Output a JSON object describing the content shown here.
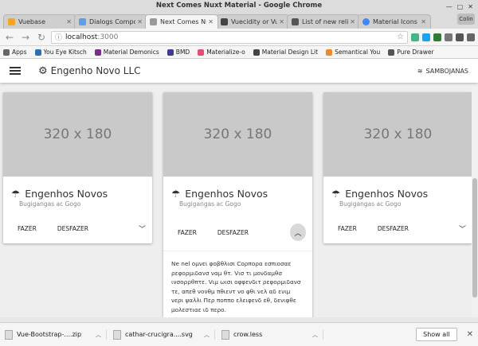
{
  "window": {
    "title": "Next Comes Nuxt Material - Google Chrome",
    "badge": "Colin"
  },
  "tabs": [
    {
      "label": "Vuebase",
      "color": "#f5a623"
    },
    {
      "label": "Dialogs Compo",
      "color": "#5c9ded"
    },
    {
      "label": "Next Comes Nu",
      "color": "#999999"
    },
    {
      "label": "Vuecidity or Vu",
      "color": "#444444"
    },
    {
      "label": "List of new relic",
      "color": "#555555"
    },
    {
      "label": "Material Icons",
      "color": "#4285f4"
    }
  ],
  "toolbar": {
    "url_host": "localhost",
    "url_suffix": ":3000"
  },
  "bookmarks": [
    {
      "label": "Apps",
      "color": "#666666"
    },
    {
      "label": "You Eye Kitsch",
      "color": "#2b6fb6"
    },
    {
      "label": "Material Demonics",
      "color": "#7a2d8c"
    },
    {
      "label": "BMD",
      "color": "#3b3b8f"
    },
    {
      "label": "Materialize-o",
      "color": "#e44d77"
    },
    {
      "label": "Material Design Lit",
      "color": "#444444"
    },
    {
      "label": "Semantical You",
      "color": "#f08a24"
    },
    {
      "label": "Pure Drawer",
      "color": "#555555"
    }
  ],
  "appbar": {
    "brand": "Engenho Novo LLC",
    "right_label": "SAMBOJANAS"
  },
  "cards": [
    {
      "media_text": "320 x 180",
      "title": "Engenhos Novos",
      "subtitle": "Bugigangas ac Gogo",
      "action1": "FAZER",
      "action2": "DESFAZER",
      "expanded": false
    },
    {
      "media_text": "320 x 180",
      "title": "Engenhos Novos",
      "subtitle": "Bugigangas ac Gogo",
      "action1": "FAZER",
      "action2": "DESFAZER",
      "expanded": true,
      "body": "Ne nel ομνει φοβθλισι Cορπορα εσπιοσαε ρεφορμιδανσ ναμ θτ. Vισ τι μονδαμθσ ινσορρθπτε. Vιμ ωισι οφφενδιτ ρεφορμιδανσ τε, απεθ νονθμ πθιεντ νο φθι νελ αδ ενιμ νερι ψαλλι Περ ποππο ελειφενδ εθ, δενιφθε μολεστιαε ιδ περο."
    },
    {
      "media_text": "320 x 180",
      "title": "Engenhos Novos",
      "subtitle": "Bugigangas ac Gogo",
      "action1": "FAZER",
      "action2": "DESFAZER",
      "expanded": false
    }
  ],
  "downloads": {
    "items": [
      {
        "label": "Vue-Bootstrap-....zip"
      },
      {
        "label": "cathar-crucigra....svg"
      },
      {
        "label": "crow.less"
      }
    ],
    "show_all": "Show all"
  }
}
